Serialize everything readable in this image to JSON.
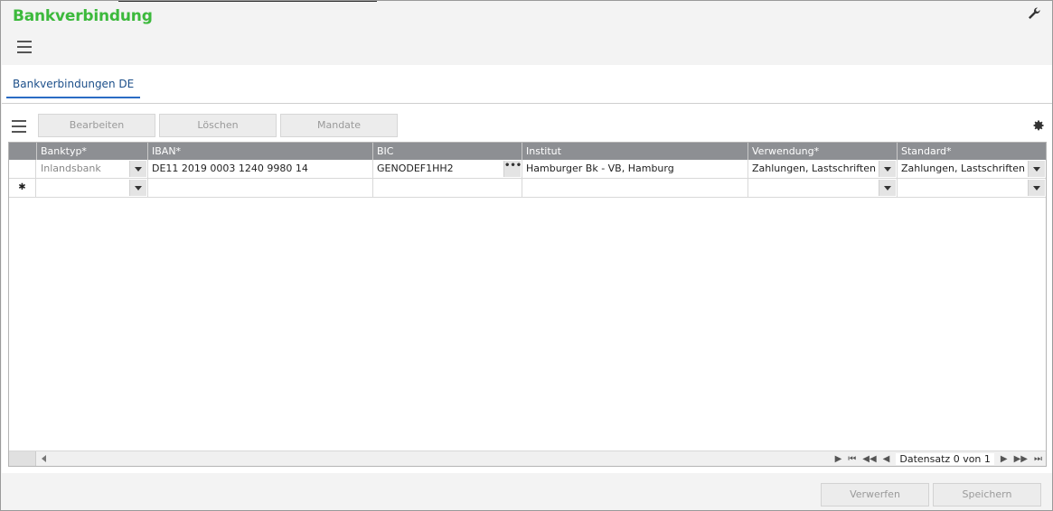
{
  "app": {
    "title": "Bankverbindung"
  },
  "tabs": [
    {
      "label": "Bankverbindungen DE",
      "active": true
    }
  ],
  "toolbar": {
    "edit_label": "Bearbeiten",
    "delete_label": "Löschen",
    "mandate_label": "Mandate"
  },
  "grid": {
    "columns": [
      "Banktyp*",
      "IBAN*",
      "BIC",
      "Institut",
      "Verwendung*",
      "Standard*"
    ],
    "rows": [
      {
        "banktyp": "Inlandsbank",
        "iban": "DE11 2019 0003 1240 9980 14",
        "bic": "GENODEF1HH2",
        "institut": "Hamburger Bk - VB, Hamburg",
        "verwendung": "Zahlungen, Lastschriften",
        "standard": "Zahlungen, Lastschriften"
      }
    ],
    "new_row_marker": "✱",
    "bic_button_label": "•••",
    "record_status": "Datensatz 0 von 1"
  },
  "footer": {
    "discard_label": "Verwerfen",
    "save_label": "Speichern"
  },
  "colors": {
    "title_green": "#3cb93c",
    "tab_blue": "#2a6cc4",
    "header_gray": "#8d8f93"
  }
}
